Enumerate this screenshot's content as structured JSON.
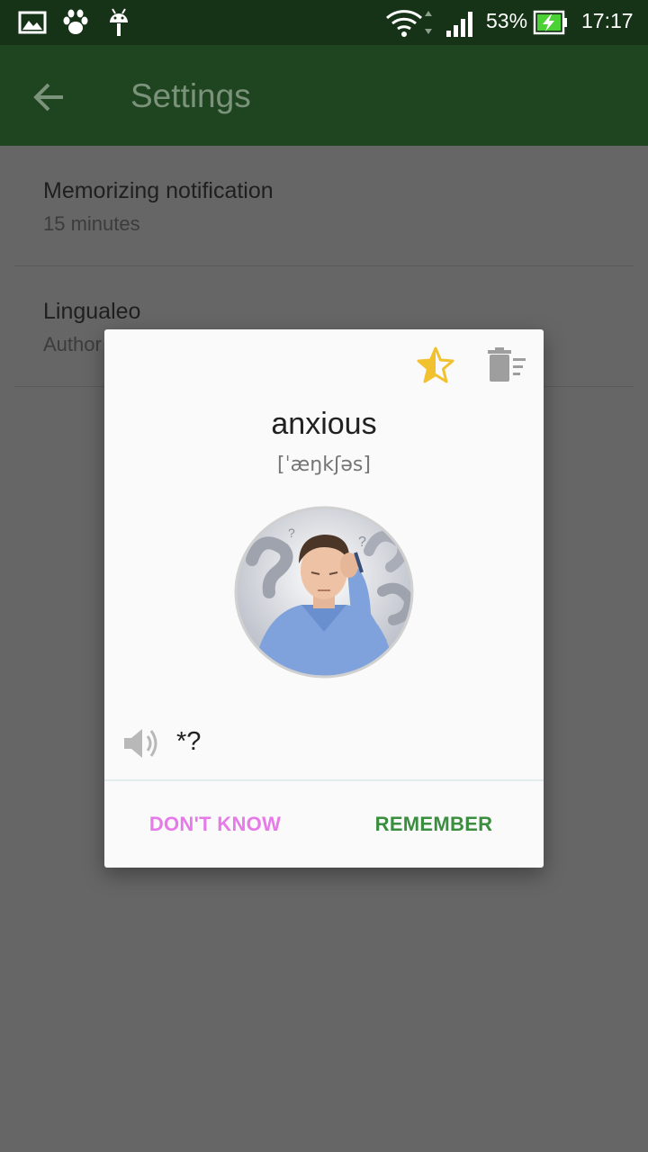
{
  "status_bar": {
    "battery_percent": "53%",
    "time": "17:17",
    "notification_icons": [
      "gallery-icon",
      "paw-icon",
      "android-icon"
    ],
    "system_icons": [
      "wifi-icon",
      "signal-icon",
      "battery-charging-icon"
    ]
  },
  "app_bar": {
    "title": "Settings",
    "back_icon": "arrow-back-icon"
  },
  "settings": {
    "items": [
      {
        "title": "Memorizing notification",
        "summary": "15 minutes"
      },
      {
        "title": "Lingualeo",
        "summary": "Author"
      }
    ]
  },
  "dialog": {
    "word": "anxious",
    "transcription": "[ˈæŋkʃəs]",
    "translation": "*?",
    "star_icon": "star-half-icon",
    "delete_icon": "delete-list-icon",
    "sound_icon": "speaker-icon",
    "picture": "anxious-man-picture",
    "buttons": {
      "dont_know": "DON'T KNOW",
      "remember": "REMEMBER"
    }
  },
  "colors": {
    "status_bar": "#163217",
    "app_bar": "#1f4520",
    "scrim_background": "#666666",
    "dialog_background": "#fafafa",
    "dont_know": "#e57ae8",
    "remember": "#3a8e3f",
    "star": "#f2c12e",
    "icon_gray": "#9e9e9e"
  }
}
